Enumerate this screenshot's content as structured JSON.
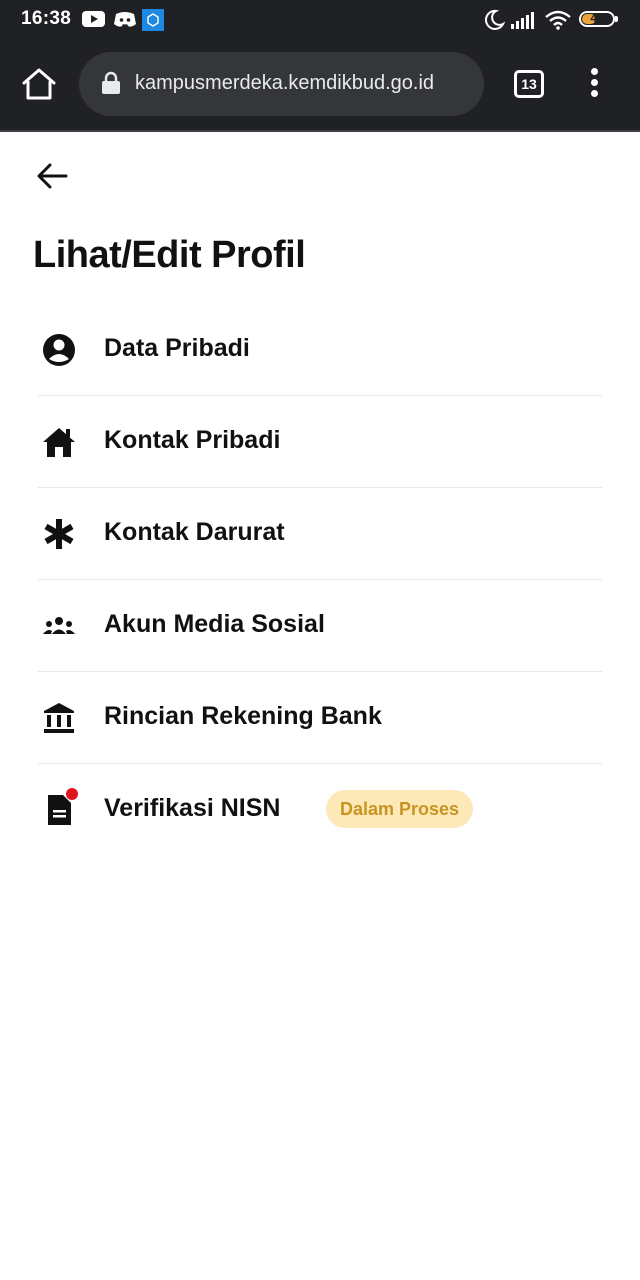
{
  "status_bar": {
    "time": "16:38",
    "battery_level": "44",
    "icons": [
      "youtube-icon",
      "discord-icon",
      "app-icon",
      "moon-icon",
      "signal-icon",
      "wifi-icon",
      "battery-icon"
    ]
  },
  "browser": {
    "url": "kampusmerdeka.kemdikbud.go.id",
    "tab_count": "13",
    "icons": [
      "home-icon",
      "lock-icon",
      "tabs-icon",
      "more-vert-icon"
    ]
  },
  "page": {
    "title": "Lihat/Edit Profil",
    "back_icon": "arrow-left-icon"
  },
  "menu": {
    "items": [
      {
        "label": "Data Pribadi",
        "icon": "account-circle-icon"
      },
      {
        "label": "Kontak Pribadi",
        "icon": "home-icon"
      },
      {
        "label": "Kontak Darurat",
        "icon": "asterisk-icon"
      },
      {
        "label": "Akun Media Sosial",
        "icon": "people-icon"
      },
      {
        "label": "Rincian Rekening Bank",
        "icon": "bank-icon"
      },
      {
        "label": "Verifikasi NISN",
        "icon": "document-icon",
        "badge": "Dalam Proses"
      }
    ]
  },
  "colors": {
    "browser_bg": "#202124",
    "badge_bg": "#fde9b8",
    "badge_text": "#c99322",
    "notification": "#e0161e",
    "battery": "#e8a33a"
  }
}
